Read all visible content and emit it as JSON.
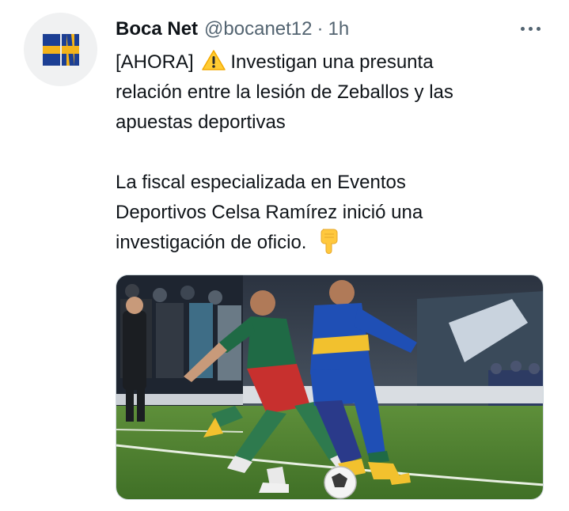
{
  "tweet": {
    "author": {
      "display_name": "Boca Net",
      "handle": "@bocanet12",
      "avatar_icon": "boca-net-logo-icon"
    },
    "separator": "·",
    "time": "1h",
    "more_icon": "more-horizontal-icon",
    "text": {
      "line1_before": "[AHORA]",
      "line1_emoji": "warning-emoji",
      "line1_after": "Investigan una presunta",
      "line2": "relación entre la lesión de Zeballos y las",
      "line3": "apuestas deportivas",
      "line4": "La fiscal especializada en Eventos",
      "line5": "Deportivos Celsa Ramírez inició una",
      "line6": "investigación de oficio.",
      "line6_emoji": "pointing-down-emoji"
    },
    "media": {
      "kind": "photo",
      "subject": "football-match-photo"
    }
  },
  "colors": {
    "text_primary": "#0f1419",
    "text_secondary": "#536471",
    "avatar_blue": "#1c3f94",
    "avatar_yellow": "#f4b31a",
    "card_border": "#cfd9de"
  }
}
